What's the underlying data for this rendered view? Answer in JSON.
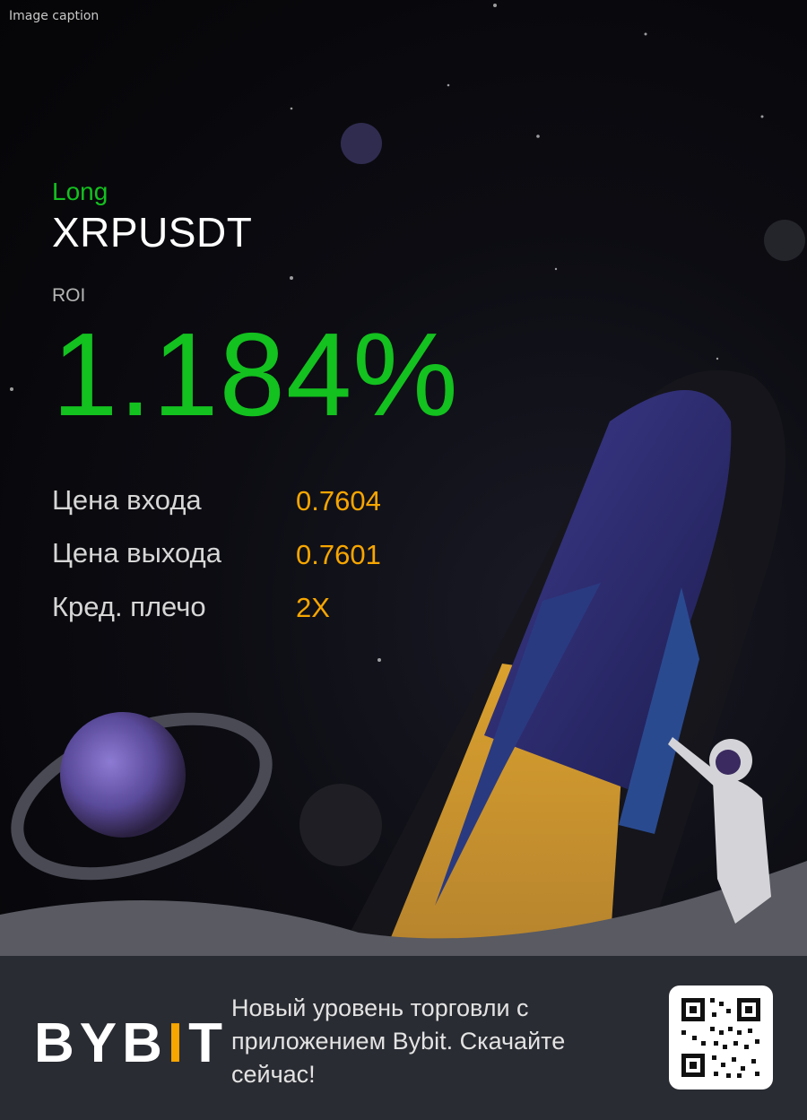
{
  "caption": "Image caption",
  "position": {
    "side": "Long",
    "pair": "XRPUSDT",
    "roi_label": "ROI",
    "roi_value": "1.184%"
  },
  "stats": [
    {
      "label": "Цена входа",
      "value": "0.7604"
    },
    {
      "label": "Цена выхода",
      "value": "0.7601"
    },
    {
      "label": "Кред. плечо",
      "value": "2X"
    }
  ],
  "footer": {
    "logo_left": "BYB",
    "logo_bar": "I",
    "logo_right": "T",
    "promo": "Новый уровень торговли с приложением Bybit. Скачайте сейчас!",
    "qr_icon": "qr-code-icon"
  },
  "colors": {
    "profit_green": "#13c11f",
    "accent_orange": "#f7a600",
    "footer_bg": "#2a2c33"
  }
}
